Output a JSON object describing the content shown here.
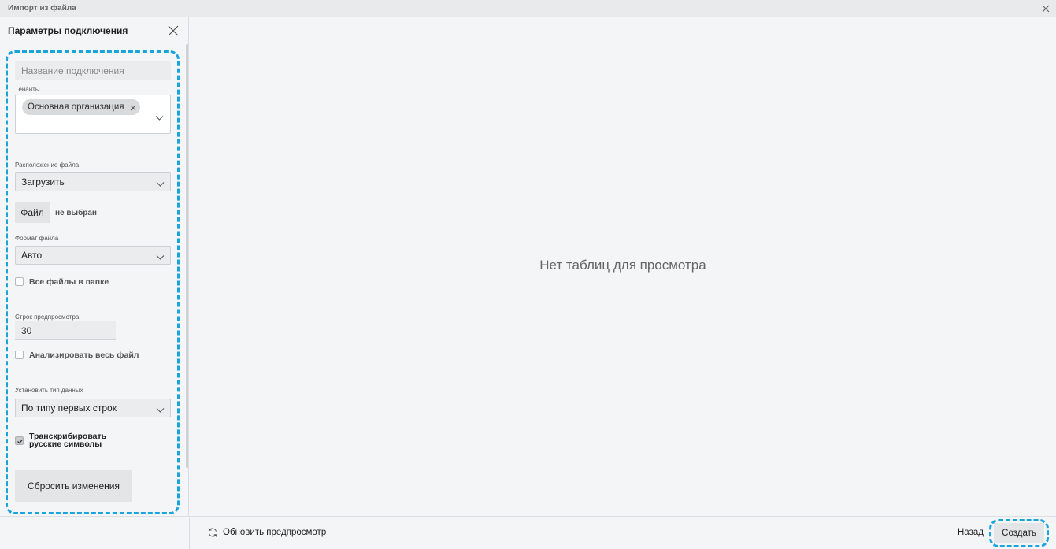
{
  "window": {
    "title": "Импорт из файла"
  },
  "sidebar": {
    "title": "Параметры подключения",
    "connection_name_placeholder": "Название подключения",
    "tenants_label": "Тенанты",
    "tenant_chip": "Основная организация",
    "file_location_label": "Расположение файла",
    "file_location_value": "Загрузить",
    "file_button": "Файл",
    "file_status": "не выбран",
    "file_format_label": "Формат файла",
    "file_format_value": "Авто",
    "all_files_label": "Все файлы в папке",
    "preview_rows_label": "Строк предпросмотра",
    "preview_rows_value": "30",
    "analyze_label": "Анализировать весь файл",
    "data_type_label": "Установить тип данных",
    "data_type_value": "По типу первых строк",
    "transcribe_line1": "Транскрибировать",
    "transcribe_line2": "русские символы",
    "transcribe_checked": true,
    "reset_button": "Сбросить изменения"
  },
  "main": {
    "empty_message": "Нет таблиц для просмотра"
  },
  "footer": {
    "refresh_label": "Обновить предпросмотр",
    "back_label": "Назад",
    "create_label": "Создать"
  },
  "colors": {
    "highlight": "#1aa4dc",
    "background": "#f4f5f7"
  }
}
